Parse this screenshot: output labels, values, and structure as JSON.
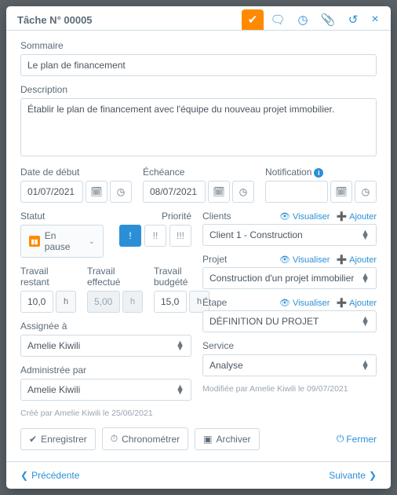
{
  "header": {
    "title": "Tâche N° 00005"
  },
  "summary": {
    "label": "Sommaire",
    "value": "Le plan de financement"
  },
  "description": {
    "label": "Description",
    "value": "Établir le plan de financement avec l'équipe du nouveau projet immobilier."
  },
  "startdate": {
    "label": "Date de début",
    "value": "01/07/2021 00:00"
  },
  "duedate": {
    "label": "Échéance",
    "value": "08/07/2021 00:00"
  },
  "notification": {
    "label": "Notification",
    "value": ""
  },
  "status": {
    "label": "Statut",
    "value": "En pause"
  },
  "priority": {
    "label": "Priorité"
  },
  "work": {
    "remain": {
      "label": "Travail restant",
      "value": "10,00",
      "unit": "h"
    },
    "done": {
      "label": "Travail effectué",
      "value": "5,00",
      "unit": "h"
    },
    "budget": {
      "label": "Travail budgété",
      "value": "15,00",
      "unit": "h"
    }
  },
  "assigned": {
    "label": "Assignée à",
    "value": "Amelie Kiwili"
  },
  "admin": {
    "label": "Administrée par",
    "value": "Amelie Kiwili"
  },
  "rel": {
    "viewLabel": "Visualiser",
    "addLabel": "Ajouter",
    "clients": {
      "label": "Clients",
      "value": "Client 1 - Construction"
    },
    "project": {
      "label": "Projet",
      "value": "Construction d'un projet immobilier"
    },
    "step": {
      "label": "Étape",
      "value": "DÉFINITION DU PROJET"
    },
    "service": {
      "label": "Service",
      "value": "Analyse"
    }
  },
  "meta": {
    "created": "Créé par Amelie Kiwili le 25/06/2021",
    "modified": "Modifiée par Amelie Kiwili le 09/07/2021"
  },
  "buttons": {
    "save": "Enregistrer",
    "timer": "Chronométrer",
    "archive": "Archiver",
    "close": "Fermer",
    "prev": "Précédente",
    "next": "Suivante"
  }
}
